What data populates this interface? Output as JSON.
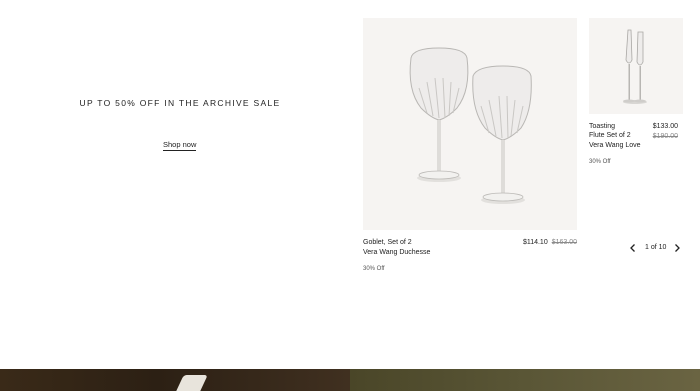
{
  "promo": {
    "title": "UP TO 50% OFF IN THE ARCHIVE SALE",
    "cta": "Shop now"
  },
  "products": [
    {
      "name_line1": "Goblet, Set of 2",
      "name_line2": "Vera Wang Duchesse",
      "price_now": "$114.10",
      "price_was": "$163.00",
      "discount": "30% Off",
      "image_icon": "goblet-pair-image"
    },
    {
      "name_line1": "Toasting",
      "name_line2": "Flute Set of 2",
      "name_line3": "Vera Wang Love",
      "price_now": "$133.00",
      "price_was": "$190.00",
      "discount": "30% Off",
      "image_icon": "flute-pair-image"
    }
  ],
  "pager": {
    "text": "1 of 10",
    "prev_icon": "chevron-left-icon",
    "next_icon": "chevron-right-icon"
  },
  "colors": {
    "background": "#ffffff",
    "image_bg": "#f6f4f2",
    "text": "#222222",
    "muted": "#8a8a8a"
  }
}
